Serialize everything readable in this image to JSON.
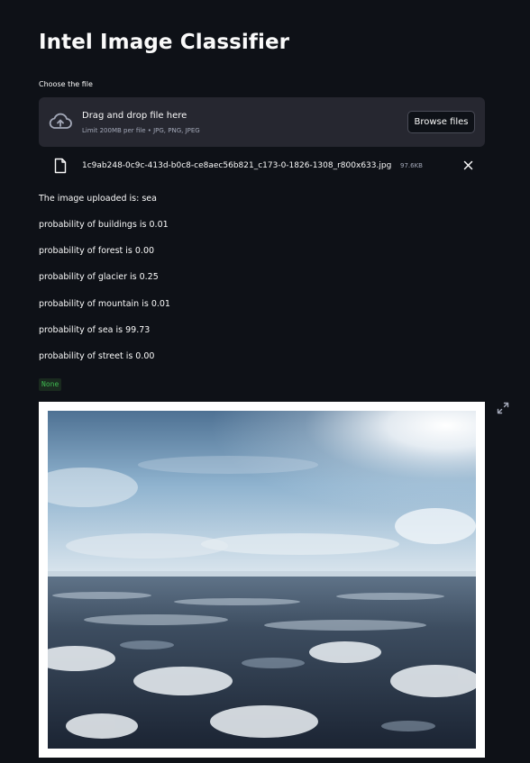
{
  "app": {
    "title": "Intel Image Classifier"
  },
  "uploader": {
    "label": "Choose the file",
    "drop_title": "Drag and drop file here",
    "drop_limit": "Limit 200MB per file • JPG, PNG, JPEG",
    "browse_label": "Browse files",
    "cloud_icon": "cloud-upload-icon"
  },
  "uploaded_file": {
    "name": "1c9ab248-0c9c-413d-b0c8-ce8aec56b821_c173-0-1826-1308_r800x633.jpg",
    "size": "97.6KB",
    "file_icon": "file-icon",
    "close_icon": "close-icon"
  },
  "results": {
    "uploaded_line": "The image uploaded is: sea",
    "probabilities": [
      "probability of buildings is 0.01",
      "probability of forest is 0.00",
      "probability of glacier is 0.25",
      "probability of mountain is 0.01",
      "probability of sea is 99.73",
      "probability of street is 0.00"
    ],
    "return_value": "None"
  },
  "image": {
    "expand_icon": "fullscreen-expand-icon"
  },
  "colors": {
    "background": "#0e1117",
    "surface": "#262730",
    "text": "#fafafa",
    "muted": "#a3a8b8",
    "badge_text": "#3fb950"
  }
}
